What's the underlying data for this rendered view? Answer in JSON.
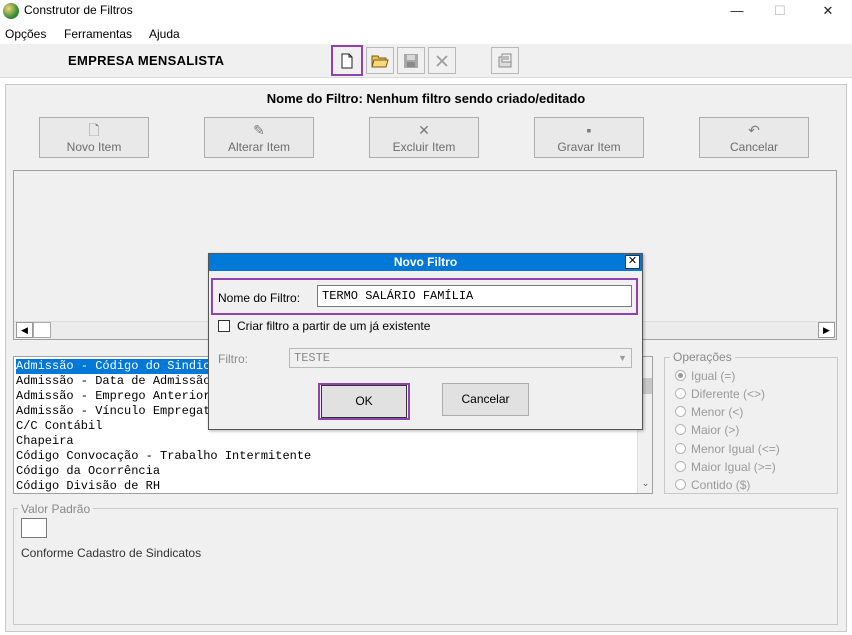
{
  "window": {
    "title": "Construtor de Filtros",
    "minimize": "—",
    "maximize": "☐",
    "close": "✕"
  },
  "menu": {
    "items": [
      "Opções",
      "Ferramentas",
      "Ajuda"
    ]
  },
  "toolbar": {
    "company": "EMPRESA MENSALISTA"
  },
  "filter_heading": "Nome do Filtro: Nenhum filtro sendo criado/editado",
  "actions": {
    "new_item": "Novo Item",
    "edit_item": "Alterar Item",
    "delete_item": "Excluir Item",
    "save_item": "Gravar Item",
    "cancel": "Cancelar"
  },
  "fields": [
    "Admissão - Código do Sindicato",
    "Admissão - Data de Admissão",
    "Admissão - Emprego Anterior",
    "Admissão - Vínculo Empregatício",
    "C/C Contábil",
    "Chapeira",
    "Código Convocação - Trabalho Intermitente",
    "Código da Ocorrência",
    "Código Divisão de RH"
  ],
  "operations": {
    "label": "Operações",
    "options": [
      "Igual (=)",
      "Diferente (<>)",
      "Menor (<)",
      "Maior (>)",
      "Menor Igual (<=)",
      "Maior Igual (>=)",
      "Contido ($)"
    ],
    "selected": "Igual (=)"
  },
  "default_value": {
    "label": "Valor Padrão",
    "text": "Conforme Cadastro de Sindicatos"
  },
  "dialog": {
    "title": "Novo Filtro",
    "close": "✕",
    "name_label": "Nome do Filtro:",
    "name_value": "TERMO SALÁRIO FAMÍLIA",
    "checkbox_label": "Criar filtro a partir de um já existente",
    "checkbox_checked": false,
    "filter_label": "Filtro:",
    "filter_value": "TESTE",
    "ok": "OK",
    "cancel": "Cancelar"
  },
  "colors": {
    "accent": "#0078d7",
    "highlight_frame": "#8e44ad"
  }
}
